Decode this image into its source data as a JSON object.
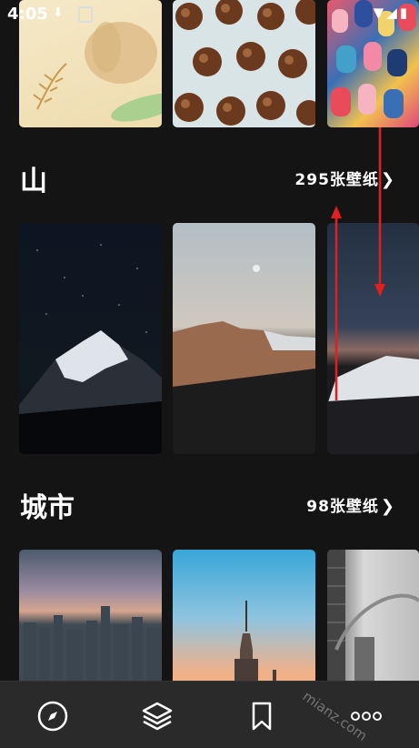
{
  "status_bar": {
    "time": "4:05"
  },
  "sections": [
    {
      "title": "山",
      "count": "295张壁纸"
    },
    {
      "title": "城市",
      "count": "98张壁纸"
    }
  ],
  "watermark": "mianz.com",
  "nav": [
    "compass-icon",
    "layers-icon",
    "bookmark-icon",
    "more-icon"
  ]
}
